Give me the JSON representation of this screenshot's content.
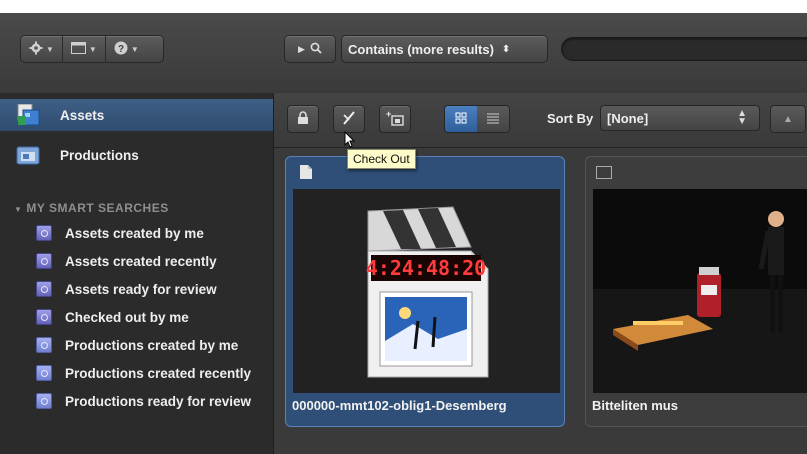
{
  "toolbar": {
    "action_menu_icon": "gear-menu-icon",
    "layout_menu_icon": "window-layout-icon",
    "help_menu_icon": "help-icon",
    "search_scope_icon": "search-icon",
    "search_mode": "Contains (more results)",
    "search_value": ""
  },
  "sidebar": {
    "main_items": [
      {
        "label": "Assets",
        "icon": "assets-icon",
        "selected": true
      },
      {
        "label": "Productions",
        "icon": "productions-icon",
        "selected": false
      }
    ],
    "section_title": "MY SMART SEARCHES",
    "smart_searches": [
      {
        "label": "Assets created by me"
      },
      {
        "label": "Assets created recently"
      },
      {
        "label": "Assets ready for review"
      },
      {
        "label": "Checked out by me"
      },
      {
        "label": "Productions created by me"
      },
      {
        "label": "Productions created recently"
      },
      {
        "label": "Productions ready for review"
      }
    ]
  },
  "content_toolbar": {
    "lock_icon": "lock-icon",
    "checkout_icon": "check-out-icon",
    "add_icon": "add-to-production-icon",
    "view_modes": [
      "grid-view-icon",
      "list-view-icon"
    ],
    "active_view": "grid",
    "sort_label": "Sort By",
    "sort_value": "[None]",
    "tooltip": "Check Out"
  },
  "assets": [
    {
      "name": "000000-mmt102-oblig1-Desemberg",
      "type_icon": "document-icon",
      "timecode": "4:24:48:20",
      "selected": true
    },
    {
      "name": "Bitteliten mus",
      "type_icon": "film-icon",
      "selected": false
    }
  ],
  "colors": {
    "selection_blue": "#2f4f78",
    "sidebar_bg": "#2b2b2b",
    "tooltip_bg": "#fdfbc9"
  }
}
